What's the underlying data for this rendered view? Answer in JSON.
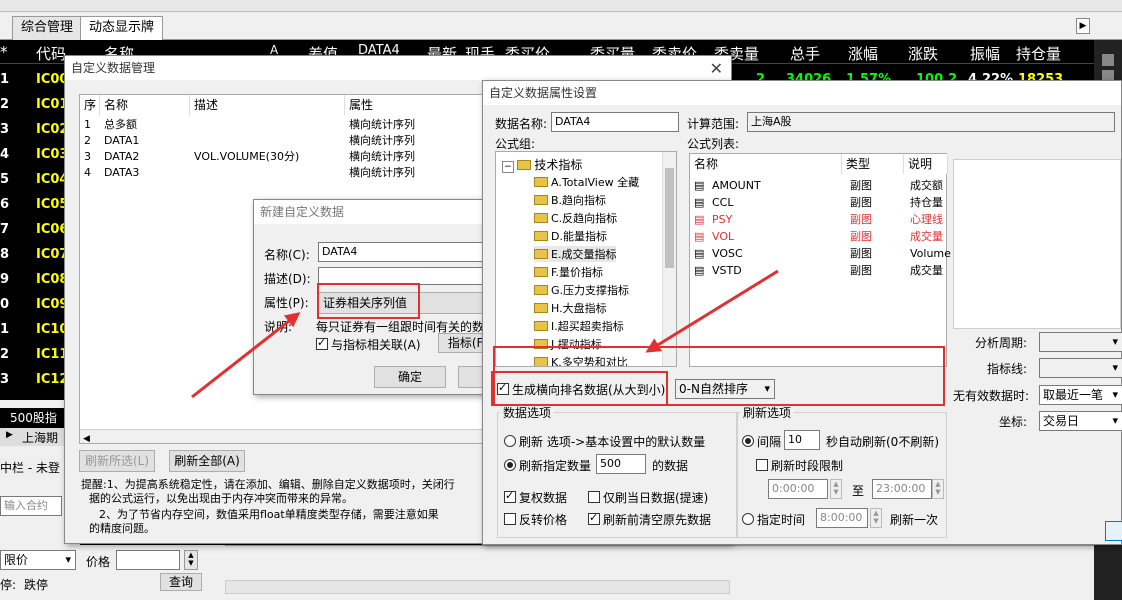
{
  "app": {
    "tabs": [
      "综合管理",
      "动态显示牌"
    ],
    "stock_quote": {
      "headers": [
        "*",
        "代码",
        "名称",
        "A",
        "差值",
        "DATA4",
        "最新",
        "现手",
        "委买价",
        "委买量",
        "委卖价",
        "委卖量",
        "总手",
        "涨幅",
        "涨跌",
        "振幅",
        "持仓量"
      ],
      "row_nums": [
        "1",
        "2",
        "3",
        "4",
        "5",
        "6",
        "7",
        "8",
        "9",
        "0",
        "1",
        "2",
        "3"
      ],
      "codes": [
        "IC00",
        "IC01",
        "IC02",
        "IC03",
        "IC04",
        "IC05",
        "IC06",
        "IC07",
        "IC08",
        "IC09",
        "IC10",
        "IC11",
        "IC12"
      ],
      "first_row_values": [
        "2",
        "34026",
        "1.57%",
        "100.2",
        "4.22%",
        "18253"
      ]
    },
    "bottom": {
      "stock_count": "500股指",
      "market_tab": "上海期",
      "status": "中栏 - 未登",
      "contract_placeholder": "输入合约",
      "price_type": "限价",
      "price_label": "价格",
      "stop_label": "停:",
      "stop_value": "跌停",
      "query_button": "查询"
    }
  },
  "custom_data_mgr": {
    "title": "自定义数据管理",
    "columns": [
      "序",
      "名称",
      "描述",
      "属性"
    ],
    "rows": [
      {
        "seq": "1",
        "name": "总多额",
        "desc": "",
        "attr": "横向统计序列"
      },
      {
        "seq": "2",
        "name": "DATA1",
        "desc": "",
        "attr": "横向统计序列"
      },
      {
        "seq": "3",
        "name": "DATA2",
        "desc": "VOL.VOLUME(30分)",
        "attr": "横向统计序列"
      },
      {
        "seq": "4",
        "name": "DATA3",
        "desc": "",
        "attr": "横向统计序列"
      }
    ],
    "refresh_selected": "刷新所选(L)",
    "refresh_all": "刷新全部(A)",
    "tip1": "提醒:1、为提高系统稳定性，请在添加、编辑、删除自定义数据项时，关闭行",
    "tip1b": "据的公式运行，以免出现由于内存冲突而带来的异常。",
    "tip2": "2、为了节省内存空间，数值采用float单精度类型存储，需要注意如果",
    "tip2b": "的精度问题。"
  },
  "new_data_dialog": {
    "title": "新建自定义数据",
    "name_label": "名称(C):",
    "name_value": "DATA4",
    "desc_label": "描述(D):",
    "desc_value": "",
    "attr_label": "属性(P):",
    "attr_value": "证券相关序列值",
    "explain_label": "说明:",
    "explain_text": "每只证券有一组跟时间有关的数",
    "link_label": "与指标相关联(A)",
    "indicator_button": "指标(F)",
    "ok_button": "确定"
  },
  "attr_dialog": {
    "title": "自定义数据属性设置",
    "data_name_label": "数据名称:",
    "data_name_value": "DATA4",
    "calc_range_label": "计算范围:",
    "calc_range_value": "上海A股",
    "formula_group_label": "公式组:",
    "tree_root": "技术指标",
    "tree_items": [
      "A.TotalView 全藏",
      "B.趋向指标",
      "C.反趋向指标",
      "D.能量指标",
      "E.成交量指标",
      "F.量价指标",
      "G.压力支撑指标",
      "H.大盘指标",
      "I.超买超卖指标",
      "J.摆动指标",
      "K.多空势和对比"
    ],
    "formula_list_label": "公式列表:",
    "formula_columns": [
      "名称",
      "类型",
      "说明"
    ],
    "formulas": [
      {
        "name": "AMOUNT",
        "type": "副图",
        "desc": "成交额",
        "highlight": false
      },
      {
        "name": "CCL",
        "type": "副图",
        "desc": "持仓量",
        "highlight": false
      },
      {
        "name": "PSY",
        "type": "副图",
        "desc": "心理线",
        "highlight": true
      },
      {
        "name": "VOL",
        "type": "副图",
        "desc": "成交量",
        "highlight": true
      },
      {
        "name": "VOSC",
        "type": "副图",
        "desc": "Volume",
        "highlight": false
      },
      {
        "name": "VSTD",
        "type": "副图",
        "desc": "成交量",
        "highlight": false
      }
    ],
    "gen_rank_label": "生成横向排名数据(从大到小)",
    "sort_value": "0-N自然排序",
    "data_options_title": "数据选项",
    "refresh_opt1": "刷新 选项->基本设置中的默认数量",
    "refresh_opt2": "刷新指定数量",
    "refresh_count": "500",
    "refresh_count_unit": "的数据",
    "restore_rights": "复权数据",
    "only_today": "仅刷当日数据(提速)",
    "reverse_price": "反转价格",
    "clear_before": "刷新前清空原先数据",
    "refresh_options_title": "刷新选项",
    "interval_label": "间隔",
    "interval_value": "10",
    "interval_unit": "秒自动刷新(0不刷新)",
    "time_limit_label": "刷新时段限制",
    "time_from": "0:00:00",
    "time_to_label": "至",
    "time_to": "23:00:00",
    "at_time_label": "指定时间",
    "at_time_value": "8:00:00",
    "refresh_once": "刷新一次",
    "period_label": "分析周期:",
    "indicator_line_label": "指标线:",
    "no_data_label": "无有效数据时:",
    "no_data_value": "取最近一笔",
    "coord_label": "坐标:",
    "coord_value": "交易日"
  },
  "colors": {
    "highlight_red": "#e03030",
    "quote_yellow": "#ffff00",
    "up_green": "#00ff00"
  }
}
